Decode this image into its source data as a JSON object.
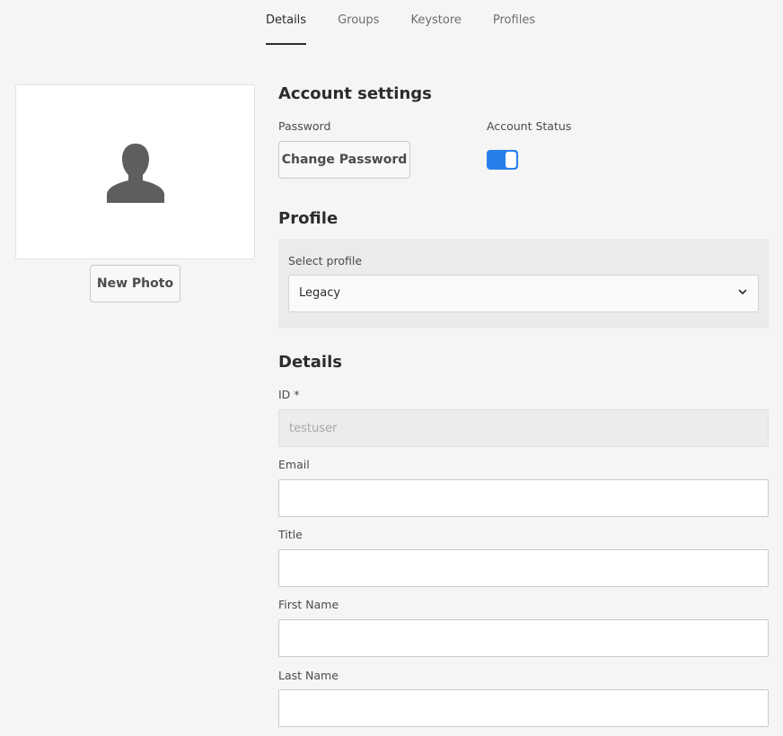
{
  "tabs": [
    {
      "label": "Details",
      "active": true
    },
    {
      "label": "Groups",
      "active": false
    },
    {
      "label": "Keystore",
      "active": false
    },
    {
      "label": "Profiles",
      "active": false
    }
  ],
  "photo": {
    "new_photo_label": "New Photo",
    "icon": "user-silhouette-icon"
  },
  "account_settings": {
    "heading": "Account settings",
    "password_label": "Password",
    "change_password_label": "Change Password",
    "status_label": "Account Status",
    "status_enabled": true
  },
  "profile": {
    "heading": "Profile",
    "select_label": "Select profile",
    "selected": "Legacy"
  },
  "details": {
    "heading": "Details",
    "id_label": "ID *",
    "id_value": "testuser",
    "email_label": "Email",
    "email_value": "",
    "title_label": "Title",
    "title_value": "",
    "first_name_label": "First Name",
    "first_name_value": "",
    "last_name_label": "Last Name",
    "last_name_value": ""
  },
  "colors": {
    "accent": "#2680eb",
    "background": "#f5f5f5"
  }
}
